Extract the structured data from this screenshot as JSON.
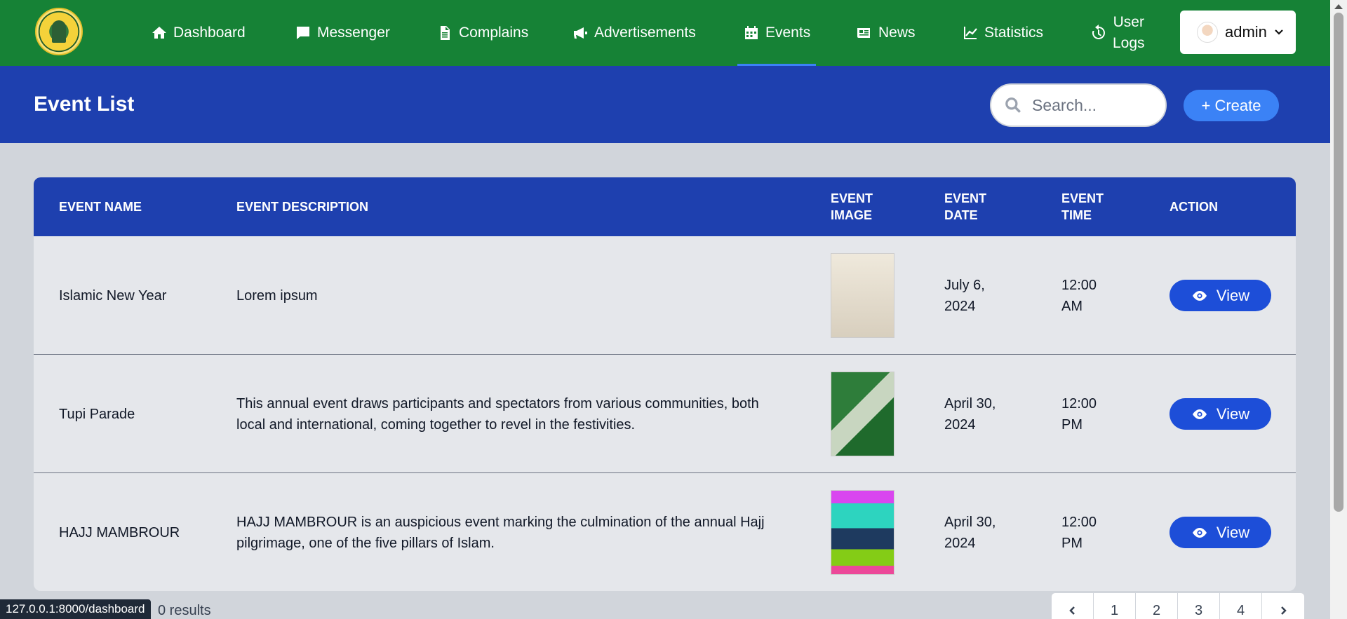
{
  "nav": {
    "items": [
      {
        "label": "Dashboard",
        "icon": "home-icon"
      },
      {
        "label": "Messenger",
        "icon": "message-icon"
      },
      {
        "label": "Complains",
        "icon": "document-icon"
      },
      {
        "label": "Advertisements",
        "icon": "megaphone-icon"
      },
      {
        "label": "Events",
        "icon": "calendar-icon",
        "active": true
      },
      {
        "label": "News",
        "icon": "newspaper-icon"
      },
      {
        "label": "Statistics",
        "icon": "chart-line-icon"
      }
    ],
    "user_logs": {
      "line1": "User",
      "line2": "Logs",
      "icon": "history-icon"
    },
    "admin_label": "admin"
  },
  "header": {
    "title": "Event List",
    "search_placeholder": "Search...",
    "create_label": "+ Create"
  },
  "table": {
    "columns": [
      {
        "l1": "EVENT NAME",
        "l2": ""
      },
      {
        "l1": "EVENT DESCRIPTION",
        "l2": ""
      },
      {
        "l1": "EVENT",
        "l2": "IMAGE"
      },
      {
        "l1": "EVENT",
        "l2": "DATE"
      },
      {
        "l1": "EVENT",
        "l2": "TIME"
      },
      {
        "l1": "ACTION",
        "l2": ""
      }
    ],
    "rows": [
      {
        "name": "Islamic New Year",
        "description": "Lorem ipsum",
        "date_l1": "July 6,",
        "date_l2": "2024",
        "time_l1": "12:00",
        "time_l2": "AM",
        "action": "View"
      },
      {
        "name": "Tupi Parade",
        "description": "This annual event draws participants and spectators from various communities, both local and international, coming together to revel in the festivities.",
        "date_l1": "April 30,",
        "date_l2": "2024",
        "time_l1": "12:00",
        "time_l2": "PM",
        "action": "View"
      },
      {
        "name": "HAJJ MAMBROUR",
        "description": "HAJJ MAMBROUR is an auspicious event marking the culmination of the annual Hajj pilgrimage, one of the five pillars of Islam.",
        "date_l1": "April 30,",
        "date_l2": "2024",
        "time_l1": "12:00",
        "time_l2": "PM",
        "action": "View"
      }
    ]
  },
  "footer": {
    "status_url": "127.0.0.1:8000/dashboard",
    "results_text": "0 results",
    "pages": [
      "1",
      "2",
      "3",
      "4"
    ]
  }
}
